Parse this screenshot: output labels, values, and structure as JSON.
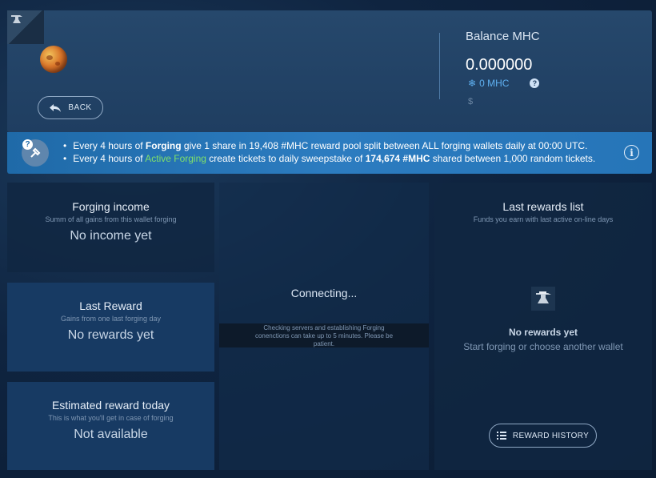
{
  "header": {
    "back_label": "BACK",
    "balance": {
      "title": "Balance MHC",
      "value": "0.000000",
      "forging_value": "0 MHC",
      "usd": "$"
    }
  },
  "banner": {
    "line1": {
      "a": "Every 4 hours of ",
      "b": "Forging",
      "c": " give 1 share in 19,408 #MHC reward pool split between ALL forging wallets daily at 00:00 UTC."
    },
    "line2": {
      "a": "Every 4 hours of ",
      "b": "Active Forging",
      "c": " create tickets to daily sweepstake of ",
      "d": "174,674 #MHC",
      "e": " shared between 1,000 random tickets."
    },
    "help_glyph": "?",
    "info_glyph": "i"
  },
  "cards": {
    "income": {
      "title": "Forging income",
      "subtitle": "Summ of all gains from this wallet forging",
      "value": "No income yet"
    },
    "last": {
      "title": "Last Reward",
      "subtitle": "Gains from one last forging day",
      "value": "No rewards yet"
    },
    "estimated": {
      "title": "Estimated reward today",
      "subtitle": "This is what you'll get in case of forging",
      "value": "Not available"
    }
  },
  "center": {
    "status": "Connecting...",
    "note": "Checking servers and establishing Forging conenctions can take up to 5 minutes. Please be patient."
  },
  "rewards": {
    "title": "Last rewards list",
    "subtitle": "Funds you earn with last active on-line days",
    "empty_title": "No rewards yet",
    "empty_sub": "Start forging or choose another wallet",
    "history_label": "REWARD HISTORY"
  },
  "icons": {
    "logo": "anvil-icon",
    "coin": "planet-coin-icon",
    "back": "back-arrow-icon",
    "forging": "snowflake-icon",
    "help": "question-icon",
    "banner": "hammer-icon",
    "info": "info-icon",
    "empty": "anvil-icon",
    "history": "list-icon"
  },
  "colors": {
    "accent": "#5fb0f0",
    "banner": "#2675b8",
    "active_forging": "#7fe06a"
  }
}
